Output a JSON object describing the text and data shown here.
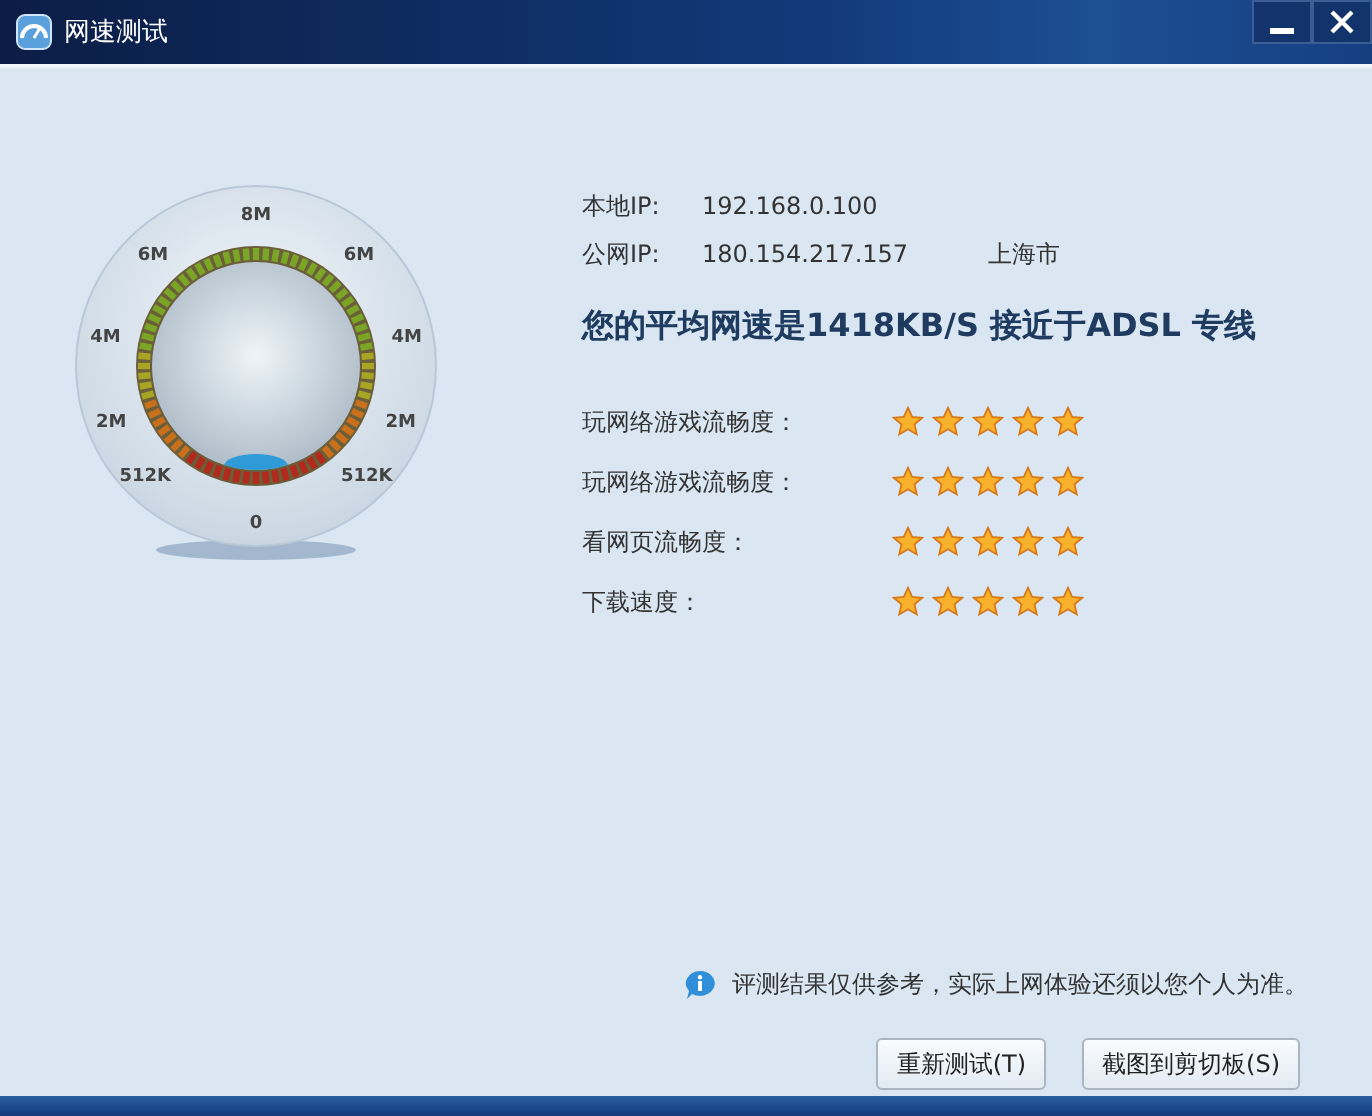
{
  "window": {
    "title": "网速测试"
  },
  "gauge": {
    "scale_labels": [
      "0",
      "512K",
      "512K",
      "2M",
      "2M",
      "4M",
      "4M",
      "6M",
      "6M",
      "8M"
    ]
  },
  "ip": [
    {
      "label": "本地IP:",
      "value": "192.168.0.100"
    },
    {
      "label": "公网IP:",
      "value": "180.154.217.157",
      "location": "上海市"
    }
  ],
  "result": "您的平均网速是1418KB/S 接近于ADSL 专线",
  "ratings": [
    {
      "label": "玩网络游戏流畅度：",
      "stars": 5
    },
    {
      "label": "玩网络游戏流畅度：",
      "stars": 5
    },
    {
      "label": "看网页流畅度：",
      "stars": 5
    },
    {
      "label": "下载速度：",
      "stars": 5
    }
  ],
  "note": "评测结果仅供参考，实际上网体验还须以您个人为准。",
  "buttons": [
    "重新测试(T)",
    "截图到剪切板(S)"
  ]
}
